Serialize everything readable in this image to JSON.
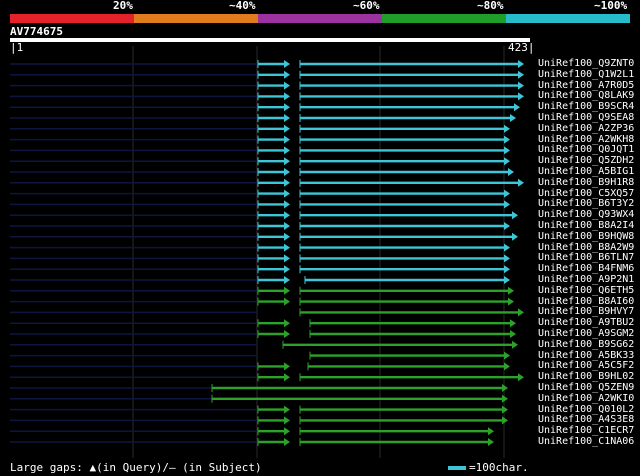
{
  "identity_scale": {
    "labels": [
      "20%",
      "~40%",
      "~60%",
      "~80%",
      "~100%"
    ],
    "colors": [
      "#e3222b",
      "#e07b1e",
      "#9b32a0",
      "#1f9e2a",
      "#26bccb"
    ]
  },
  "query": {
    "id": "AV774675",
    "start": "1",
    "end": "423"
  },
  "hit_colors": {
    "high": "#3ec6d6",
    "mid": "#2ca22a",
    "trace": "#0d1640"
  },
  "hits": [
    {
      "label": "UniRef100_Q9ZNT0",
      "color": "high"
    },
    {
      "label": "UniRef100_Q1W2L1",
      "color": "high"
    },
    {
      "label": "UniRef100_A7R0D5",
      "color": "high"
    },
    {
      "label": "UniRef100_Q8LAK9",
      "color": "high"
    },
    {
      "label": "UniRef100_B9SCR4",
      "color": "high"
    },
    {
      "label": "UniRef100_Q9SEA8",
      "color": "high"
    },
    {
      "label": "UniRef100_A2ZP36",
      "color": "high"
    },
    {
      "label": "UniRef100_A2WKH8",
      "color": "high"
    },
    {
      "label": "UniRef100_Q0JQT1",
      "color": "high"
    },
    {
      "label": "UniRef100_Q5ZDH2",
      "color": "high"
    },
    {
      "label": "UniRef100_A5BIG1",
      "color": "high"
    },
    {
      "label": "UniRef100_B9H1R8",
      "color": "high"
    },
    {
      "label": "UniRef100_C5XQ57",
      "color": "high"
    },
    {
      "label": "UniRef100_B6T3Y2",
      "color": "high"
    },
    {
      "label": "UniRef100_Q93WX4",
      "color": "high"
    },
    {
      "label": "UniRef100_B8A2I4",
      "color": "high"
    },
    {
      "label": "UniRef100_B9HQW8",
      "color": "high"
    },
    {
      "label": "UniRef100_B8A2W9",
      "color": "high"
    },
    {
      "label": "UniRef100_B6TLN7",
      "color": "high"
    },
    {
      "label": "UniRef100_B4FNM6",
      "color": "high"
    },
    {
      "label": "UniRef100_A9P2N1",
      "color": "high"
    },
    {
      "label": "UniRef100_Q6ETH5",
      "color": "mid"
    },
    {
      "label": "UniRef100_B8AI60",
      "color": "mid"
    },
    {
      "label": "UniRef100_B9HVY7",
      "color": "mid"
    },
    {
      "label": "UniRef100_A9TBU2",
      "color": "mid"
    },
    {
      "label": "UniRef100_A9SGM2",
      "color": "mid"
    },
    {
      "label": "UniRef100_B9SG62",
      "color": "mid"
    },
    {
      "label": "UniRef100_A5BK33",
      "color": "mid"
    },
    {
      "label": "UniRef100_A5C5F2",
      "color": "mid"
    },
    {
      "label": "UniRef100_B9HL02",
      "color": "mid"
    },
    {
      "label": "UniRef100_Q5ZEN9",
      "color": "mid"
    },
    {
      "label": "UniRef100_A2WKI0",
      "color": "mid"
    },
    {
      "label": "UniRef100_Q010L2",
      "color": "mid"
    },
    {
      "label": "UniRef100_A4S3E8",
      "color": "mid"
    },
    {
      "label": "UniRef100_C1ECR7",
      "color": "mid"
    },
    {
      "label": "UniRef100_C1NA06",
      "color": "mid"
    }
  ],
  "footer": {
    "gaps_text": "Large gaps: ▲(in Query)/— (in Subject)",
    "scale_text": "=100char."
  }
}
